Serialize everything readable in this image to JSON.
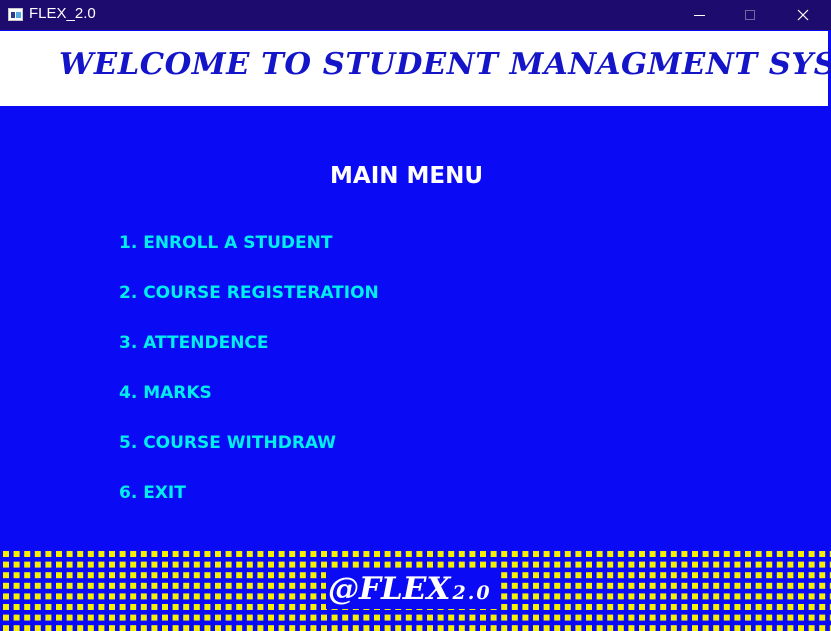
{
  "window": {
    "title": "FLEX_2.0"
  },
  "banner": {
    "text": "WELCOME TO STUDENT MANAGMENT SYSTEM"
  },
  "menu": {
    "heading": "MAIN MENU",
    "items": [
      {
        "label": "1. ENROLL A STUDENT"
      },
      {
        "label": "2. COURSE REGISTERATION"
      },
      {
        "label": "3. ATTENDENCE"
      },
      {
        "label": "4. MARKS"
      },
      {
        "label": "5. COURSE WITHDRAW"
      },
      {
        "label": "6. EXIT"
      }
    ]
  },
  "footer": {
    "logo_main": "@FLEX",
    "logo_version": "2.0"
  },
  "colors": {
    "background": "#0a0af5",
    "titlebar": "#1e0b6e",
    "banner_text": "#1414c8",
    "menu_item": "#00eeee",
    "footer_dots": "#f5f000"
  }
}
